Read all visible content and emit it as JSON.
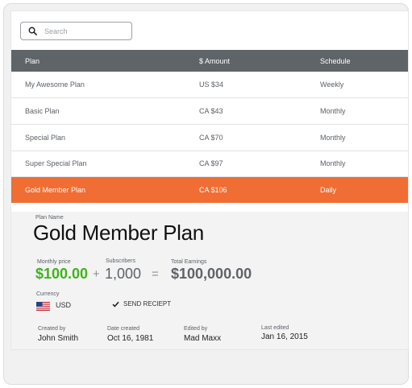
{
  "search": {
    "placeholder": "Search"
  },
  "table": {
    "headers": [
      "Plan",
      "$ Amount",
      "Schedule"
    ],
    "rows": [
      {
        "plan": "My Awesome Plan",
        "amount": "US $34",
        "schedule": "Weekly"
      },
      {
        "plan": "Basic Plan",
        "amount": "CA $43",
        "schedule": "Monthly"
      },
      {
        "plan": "Special Plan",
        "amount": "CA $70",
        "schedule": "Monthly"
      },
      {
        "plan": "Super Special Plan",
        "amount": "CA $97",
        "schedule": "Monthly"
      },
      {
        "plan": "Gold Member Plan",
        "amount": "CA $106",
        "schedule": "Daily"
      }
    ],
    "selected_index": 4
  },
  "detail": {
    "plan_name_label": "Plan Name",
    "plan_name": "Gold Member Plan",
    "monthly_price_label": "Monthly price",
    "monthly_price": "$100.00",
    "plus": "+",
    "subscribers_label": "Subscribers",
    "subscribers": "1,000",
    "equals": "=",
    "total_earnings_label": "Total Earnings",
    "total_earnings": "$100,000.00",
    "currency_label": "Currency",
    "currency": "USD",
    "send_receipt": "SEND RECIEPT",
    "created_by_label": "Created by",
    "created_by": "John Smith",
    "date_created_label": "Date created",
    "date_created": "Oct 16, 1981",
    "edited_by_label": "Edited by",
    "edited_by": "Mad Maxx",
    "last_edited_label": "Last edited",
    "last_edited": "Jan 16, 2015"
  },
  "colors": {
    "header_bg": "#5f6469",
    "selected_row": "#f06d33",
    "price_green": "#3fb21d"
  },
  "icons": {
    "search": "search-icon",
    "check": "checkmark-icon",
    "flag": "us-flag-icon"
  }
}
